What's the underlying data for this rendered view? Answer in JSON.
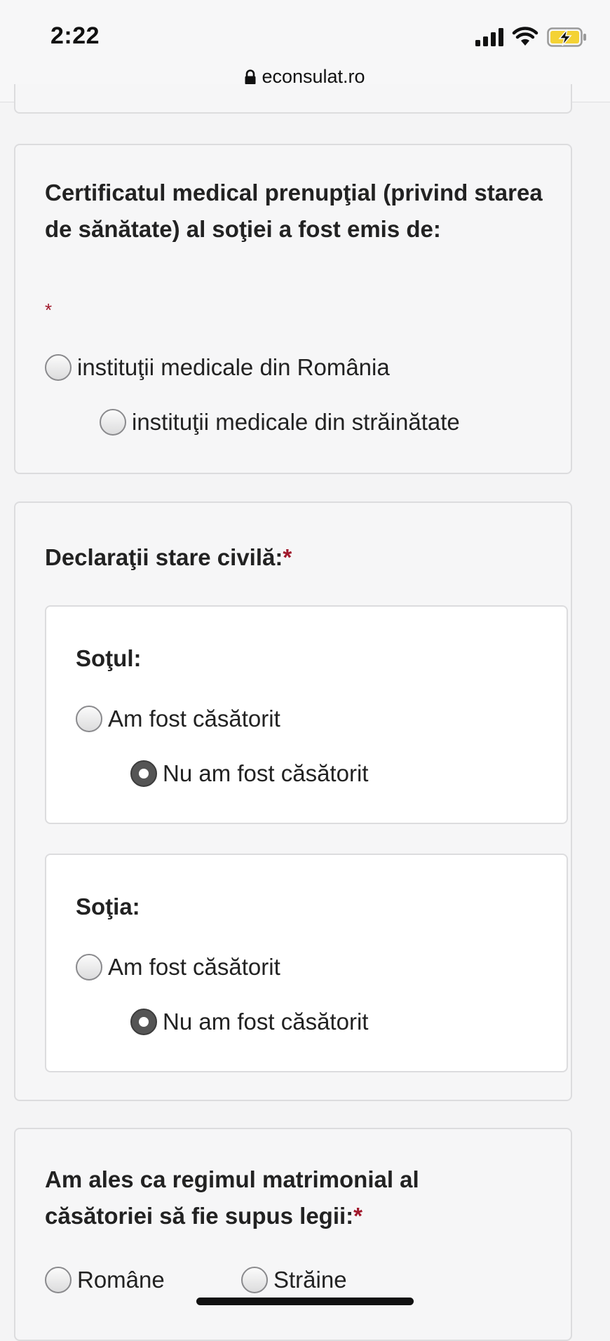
{
  "status_bar": {
    "time": "2:22"
  },
  "browser": {
    "url": "econsulat.ro"
  },
  "questions": {
    "medical_certificate": {
      "label": "Certificatul medical prenupţial (privind starea de sănătate) al soţiei a fost emis de:",
      "required_mark": "*",
      "options": [
        {
          "label": "instituţii medicale din România",
          "checked": false
        },
        {
          "label": "instituţii medicale din străinătate",
          "checked": false
        }
      ]
    },
    "civil_status": {
      "label": "Declaraţii stare civilă:",
      "required_mark": "*",
      "husband": {
        "label": "Soţul:",
        "options": [
          {
            "label": "Am fost căsătorit",
            "checked": false
          },
          {
            "label": "Nu am fost căsătorit",
            "checked": true
          }
        ]
      },
      "wife": {
        "label": "Soţia:",
        "options": [
          {
            "label": "Am fost căsătorit",
            "checked": false
          },
          {
            "label": "Nu am fost căsătorit",
            "checked": true
          }
        ]
      }
    },
    "matrimonial_regime": {
      "label_line1": "Am ales ca regimul matrimonial al",
      "label_line2": "căsătoriei să fie supus legii:",
      "required_mark": "*",
      "options": [
        {
          "label": "Române",
          "checked": false
        },
        {
          "label": "Străine",
          "checked": false
        }
      ]
    }
  }
}
